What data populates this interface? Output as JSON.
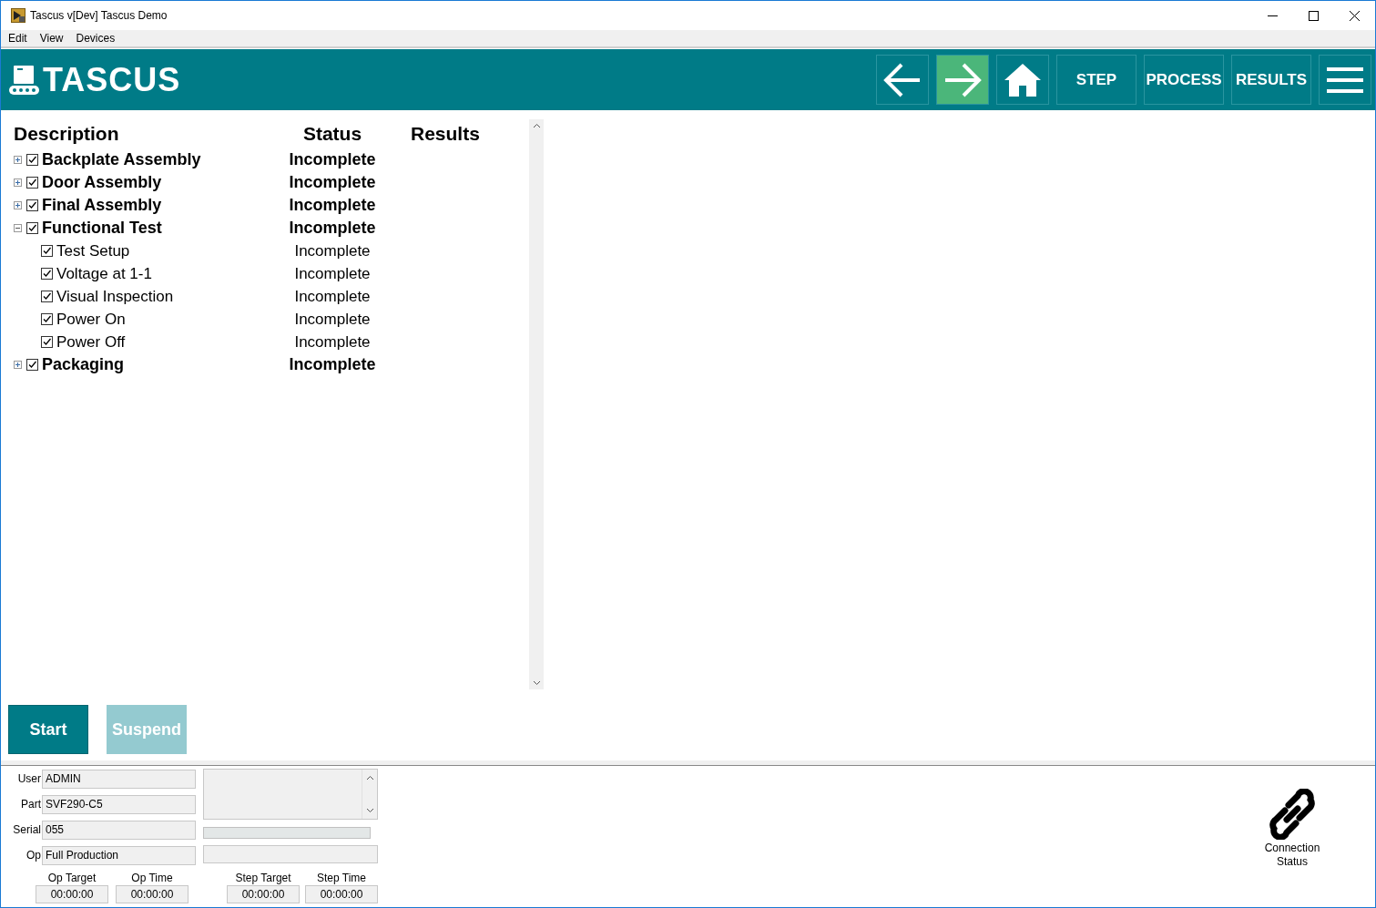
{
  "window": {
    "title": "Tascus  v[Dev] Tascus Demo"
  },
  "menu": [
    "Edit",
    "View",
    "Devices"
  ],
  "header": {
    "logo": "TASCUS",
    "nav": [
      {
        "kind": "back",
        "selected": false
      },
      {
        "kind": "forward",
        "selected": true
      },
      {
        "kind": "home",
        "selected": false
      },
      {
        "kind": "text",
        "label": "STEP",
        "selected": false
      },
      {
        "kind": "text",
        "label": "PROCESS",
        "selected": false
      },
      {
        "kind": "text",
        "label": "RESULTS",
        "selected": false
      },
      {
        "kind": "menu",
        "selected": false
      }
    ]
  },
  "tree": {
    "columns": [
      "Description",
      "Status",
      "Results"
    ],
    "items": [
      {
        "label": "Backplate Assembly",
        "status": "Incomplete",
        "checked": true,
        "expanded": false
      },
      {
        "label": "Door Assembly",
        "status": "Incomplete",
        "checked": true,
        "expanded": false
      },
      {
        "label": "Final Assembly",
        "status": "Incomplete",
        "checked": true,
        "expanded": false
      },
      {
        "label": "Functional Test",
        "status": "Incomplete",
        "checked": true,
        "expanded": true,
        "children": [
          {
            "label": "Test Setup",
            "status": "Incomplete",
            "checked": true
          },
          {
            "label": "Voltage at 1-1",
            "status": "Incomplete",
            "checked": true
          },
          {
            "label": "Visual Inspection",
            "status": "Incomplete",
            "checked": true
          },
          {
            "label": "Power On",
            "status": "Incomplete",
            "checked": true
          },
          {
            "label": "Power Off",
            "status": "Incomplete",
            "checked": true
          }
        ]
      },
      {
        "label": "Packaging",
        "status": "Incomplete",
        "checked": true,
        "expanded": false
      }
    ]
  },
  "actions": [
    {
      "label": "Start",
      "disabled": false
    },
    {
      "label": "Suspend",
      "disabled": true
    }
  ],
  "info": {
    "fields": [
      {
        "label": "User",
        "value": "ADMIN"
      },
      {
        "label": "Part",
        "value": "SVF290-C5"
      },
      {
        "label": "Serial",
        "value": "055"
      },
      {
        "label": "Op",
        "value": "Full Production"
      }
    ],
    "progress": {
      "level": 0
    },
    "timers": [
      {
        "label": "Op Target",
        "value": "00:00:00"
      },
      {
        "label": "Op Time",
        "value": "00:00:00"
      },
      {
        "label": "Step Target",
        "value": "00:00:00"
      },
      {
        "label": "Step Time",
        "value": "00:00:00"
      }
    ],
    "connection": "Connection Status"
  }
}
